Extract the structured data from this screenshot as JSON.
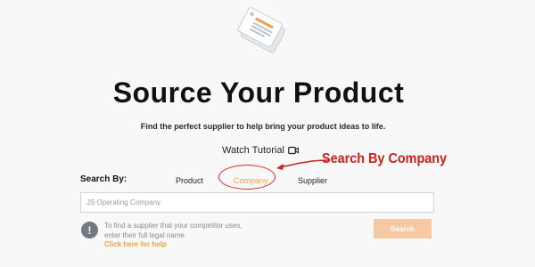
{
  "hero": {
    "title": "Source Your Product",
    "subtitle": "Find the perfect supplier to help bring your product ideas to life."
  },
  "tutorial": {
    "label": "Watch Tutorial"
  },
  "search": {
    "by_label": "Search By:",
    "tabs": [
      {
        "label": "Product"
      },
      {
        "label": "Company",
        "active": true
      },
      {
        "label": "Supplier"
      }
    ],
    "input_value": "JS Operating Company",
    "button_label": "Search"
  },
  "help": {
    "line1": "To find a supplier that your competitor uses,",
    "line2": "enter their full legal name.",
    "link": "Click here for help"
  },
  "annotation": {
    "text": "Search By Company"
  },
  "colors": {
    "accent": "#f2a33c",
    "annotation": "#c8201b",
    "button": "#f6c9a3",
    "info_icon": "#6f7b80"
  }
}
